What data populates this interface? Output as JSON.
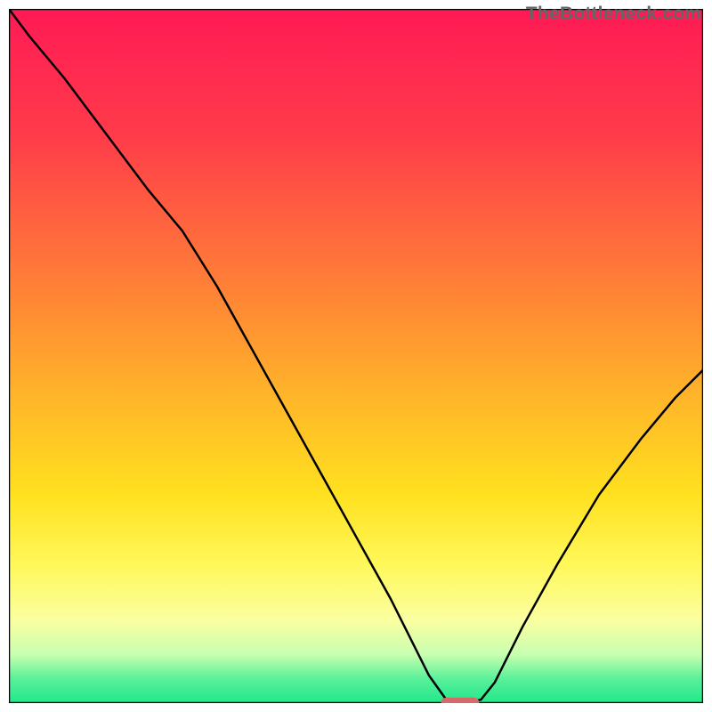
{
  "watermark": "TheBottleneck.com",
  "chart_data": {
    "type": "line",
    "title": "",
    "xlabel": "",
    "ylabel": "",
    "xlim": [
      0,
      100
    ],
    "ylim": [
      0,
      100
    ],
    "grid": false,
    "legend": false,
    "background_gradient": {
      "stops": [
        {
          "offset": 0.0,
          "color": "#ff1a55"
        },
        {
          "offset": 0.18,
          "color": "#ff3b4a"
        },
        {
          "offset": 0.38,
          "color": "#ff7a38"
        },
        {
          "offset": 0.55,
          "color": "#ffb22a"
        },
        {
          "offset": 0.7,
          "color": "#ffe11f"
        },
        {
          "offset": 0.8,
          "color": "#fff85a"
        },
        {
          "offset": 0.88,
          "color": "#fbffa0"
        },
        {
          "offset": 0.93,
          "color": "#c8ffb0"
        },
        {
          "offset": 0.965,
          "color": "#5af09a"
        },
        {
          "offset": 1.0,
          "color": "#20e88b"
        }
      ]
    },
    "series": [
      {
        "name": "bottleneck-curve",
        "x": [
          0.0,
          3.0,
          8.0,
          14.0,
          20.0,
          25.0,
          30.0,
          35.0,
          40.0,
          45.0,
          50.0,
          55.0,
          60.5,
          63.0,
          65.5,
          68.0,
          70.0,
          74.0,
          79.0,
          85.0,
          91.0,
          96.0,
          100.0
        ],
        "y": [
          100.0,
          96.0,
          90.0,
          82.0,
          74.0,
          68.0,
          60.0,
          51.0,
          42.0,
          33.0,
          24.0,
          15.0,
          4.0,
          0.5,
          0.0,
          0.5,
          3.0,
          11.0,
          20.0,
          30.0,
          38.0,
          44.0,
          48.0
        ]
      }
    ],
    "marker": {
      "name": "minimum-point",
      "x": 65.0,
      "y": 0.0,
      "width_pct": 5.5,
      "height_pct": 1.6,
      "color": "#d46a6a"
    }
  }
}
